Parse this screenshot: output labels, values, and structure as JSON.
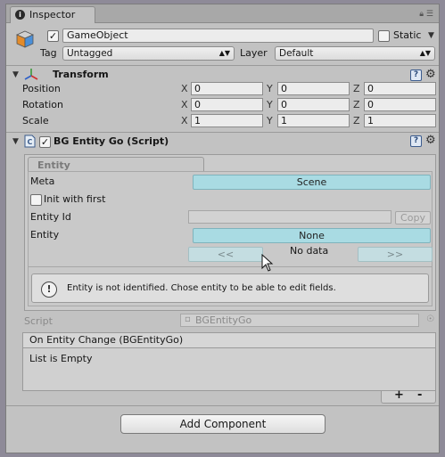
{
  "window": {
    "tab_title": "Inspector",
    "tab_icon": "info-icon"
  },
  "gameobject": {
    "active": true,
    "name": "GameObject",
    "static_label": "Static",
    "static_checked": false,
    "tag_label": "Tag",
    "tag_value": "Untagged",
    "layer_label": "Layer",
    "layer_value": "Default"
  },
  "transform": {
    "title": "Transform",
    "rows": [
      {
        "label": "Position",
        "x": "0",
        "y": "0",
        "z": "0"
      },
      {
        "label": "Rotation",
        "x": "0",
        "y": "0",
        "z": "0"
      },
      {
        "label": "Scale",
        "x": "1",
        "y": "1",
        "z": "1"
      }
    ],
    "axis": {
      "x": "X",
      "y": "Y",
      "z": "Z"
    }
  },
  "script_component": {
    "title": "BG Entity Go (Script)",
    "enabled": true,
    "tab_label": "Entity",
    "meta_label": "Meta",
    "meta_value": "Scene",
    "init_with_first_label": "Init with first",
    "init_with_first_checked": false,
    "entity_id_label": "Entity Id",
    "copy_label": "Copy",
    "entity_label": "Entity",
    "entity_value": "None",
    "prev_label": "<<",
    "next_label": ">>",
    "no_data_label": "No data",
    "help_text": "Entity is not identified. Chose entity to be able to edit fields.",
    "script_label": "Script",
    "script_value": "BGEntityGo"
  },
  "event_list": {
    "header": "On Entity Change (BGEntityGo)",
    "empty_text": "List is Empty",
    "add_label": "+",
    "remove_label": "-"
  },
  "add_component_label": "Add Component",
  "colors": {
    "accent_button": "#a9dbe3",
    "panel_bg": "#c2c2c2"
  }
}
